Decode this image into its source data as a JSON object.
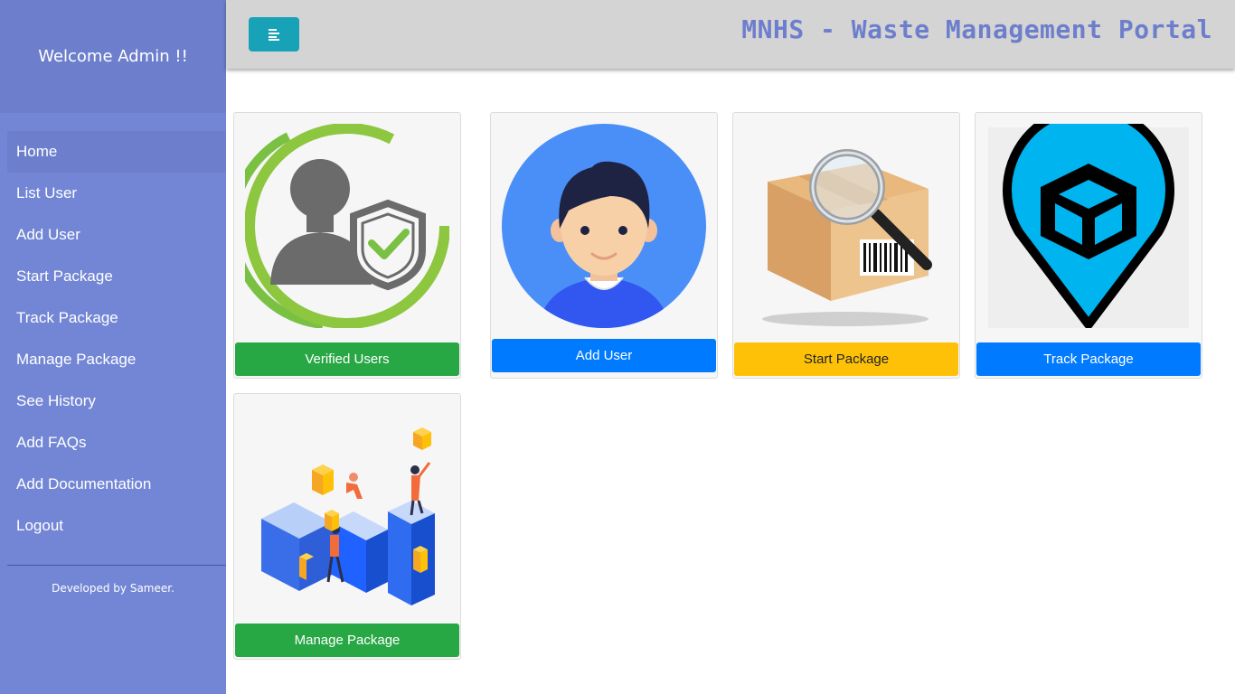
{
  "sidebar": {
    "welcome": "Welcome Admin !!",
    "items": [
      {
        "label": "Home"
      },
      {
        "label": "List User"
      },
      {
        "label": "Add User"
      },
      {
        "label": "Start Package"
      },
      {
        "label": "Track Package"
      },
      {
        "label": "Manage Package"
      },
      {
        "label": "See History"
      },
      {
        "label": "Add FAQs"
      },
      {
        "label": "Add Documentation"
      },
      {
        "label": "Logout"
      }
    ],
    "footer": "Developed by Sameer."
  },
  "header": {
    "title": "MNHS - Waste Management Portal",
    "menu_icon": "align-left-icon"
  },
  "cards": [
    {
      "label": "Verified Users",
      "icon": "verified-user-shield-icon"
    },
    {
      "label": "Add User",
      "icon": "user-avatar-icon"
    },
    {
      "label": "Start Package",
      "icon": "package-magnifier-icon"
    },
    {
      "label": "Track Package",
      "icon": "location-pin-box-icon"
    },
    {
      "label": "Manage Package",
      "icon": "isometric-team-blocks-illustration"
    }
  ],
  "colors": {
    "sidebar": "#7386D5",
    "sidebar_dark": "#6d7fcc",
    "topbar": "#d4d4d4",
    "menu_button": "#17a2b8",
    "green": "#28a745",
    "blue": "#007bff",
    "yellow": "#ffc107"
  }
}
